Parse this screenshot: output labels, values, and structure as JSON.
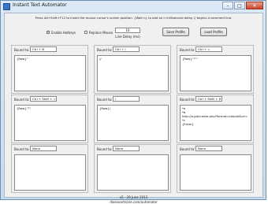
{
  "window": {
    "title": "Instant Text Automator",
    "minimize_glyph": "–",
    "maximize_glyph": "□",
    "close_glyph": "✕"
  },
  "header": {
    "hint": "Press Alt+Shift+F12 to insert the mouse cursor's screen position.   {Wait n} to add an n millisecond delay.   // begins a comment line.",
    "enable_hotkeys": {
      "label": "Enable Hotkeys",
      "checked": true
    },
    "replace_mouse": {
      "label": "Replace Mouse",
      "checked": false
    },
    "line_delay": {
      "value": "10",
      "label": "Line Delay (ms)"
    },
    "save_profile_label": "Save Profile",
    "load_profile_label": "Load Profile"
  },
  "bound_to_label": "Bound to:",
  "slots": [
    {
      "hotkey": "Ctrl + B",
      "text": "{Raw}\""
    },
    {
      "hotkey": "Ctrl + /",
      "text": "//"
    },
    {
      "hotkey": "Ctrl + =",
      "text": "{Raw}\"\"\"\""
    },
    {
      "hotkey": "Ctrl + Shift + =",
      "text": "{Raw}\"\"\""
    },
    {
      "hotkey": "\\",
      "text": "{Raw}\\"
    },
    {
      "hotkey": "Ctrl + Shift + 8",
      "text": "*a\n*b\nhttp://a.gd/create.php?format=simple&url=\n*c\n{Enter}"
    },
    {
      "hotkey": "None",
      "text": ""
    },
    {
      "hotkey": "None",
      "text": ""
    },
    {
      "hotkey": "None",
      "text": ""
    }
  ],
  "footer": {
    "version": "v5 - 26 June 2013",
    "website": "dieseuartsane.com/automator"
  }
}
